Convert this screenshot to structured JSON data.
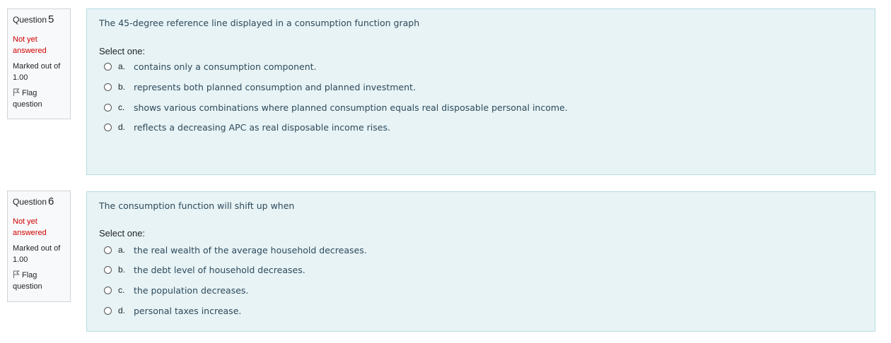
{
  "questions": [
    {
      "label": "Question",
      "number": "5",
      "status": "Not yet answered",
      "marked": "Marked out of 1.00",
      "flag": "Flag question",
      "text": "The 45-degree reference line displayed in a consumption function graph",
      "prompt": "Select one:",
      "options": [
        {
          "letter": "a.",
          "text": "contains only a consumption component."
        },
        {
          "letter": "b.",
          "text": "represents both planned consumption and planned investment."
        },
        {
          "letter": "c.",
          "text": "shows various combinations where planned consumption equals real disposable personal income."
        },
        {
          "letter": "d.",
          "text": "reflects a decreasing APC as real disposable income rises."
        }
      ]
    },
    {
      "label": "Question",
      "number": "6",
      "status": "Not yet answered",
      "marked": "Marked out of 1.00",
      "flag": "Flag question",
      "text": "The consumption function will shift up when",
      "prompt": "Select one:",
      "options": [
        {
          "letter": "a.",
          "text": "the real wealth of the average household decreases."
        },
        {
          "letter": "b.",
          "text": "the debt level of household decreases."
        },
        {
          "letter": "c.",
          "text": "the population decreases."
        },
        {
          "letter": "d.",
          "text": "personal taxes increase."
        }
      ]
    }
  ],
  "colors": {
    "status": "#d00000",
    "content_bg": "#e7f3f5",
    "content_border": "#b8dce2",
    "question_text": "#2e4a5b"
  },
  "icons": {
    "flag": "flag-icon",
    "radio": "radio-icon"
  }
}
